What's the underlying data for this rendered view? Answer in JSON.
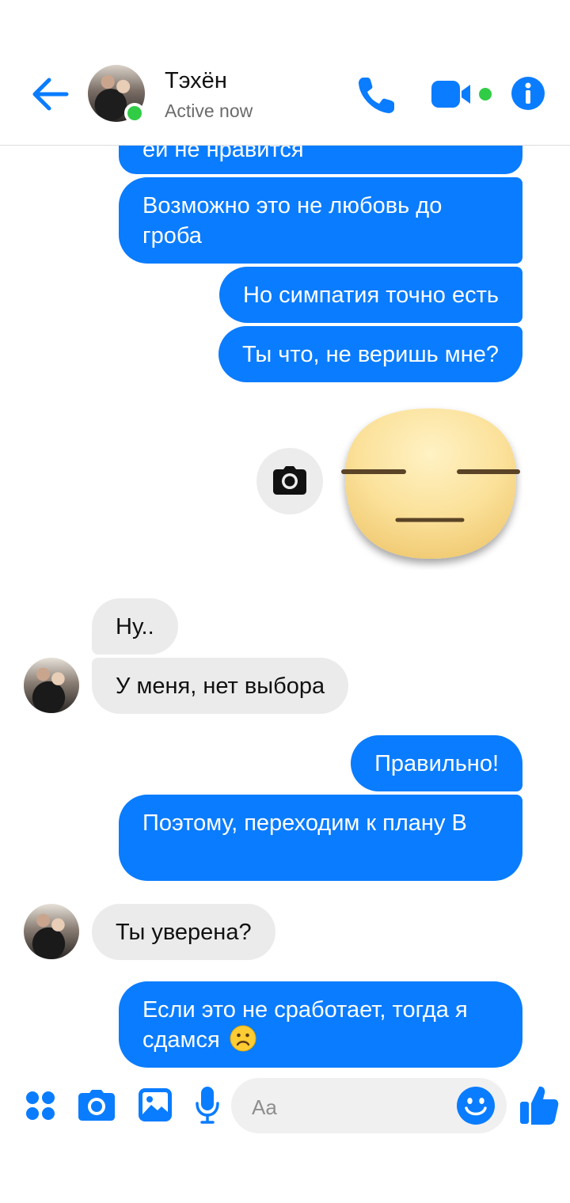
{
  "header": {
    "contact_name": "Тэхён",
    "status": "Active now"
  },
  "colors": {
    "accent": "#0a7cff",
    "incoming_bubble": "#ebebeb",
    "online": "#31cc46"
  },
  "messages": [
    {
      "side": "out",
      "text": "ей не нравится"
    },
    {
      "side": "out",
      "text": "Возможно это не любовь до гроба"
    },
    {
      "side": "out",
      "text": "Но симпатия точно есть"
    },
    {
      "side": "out",
      "text": "Ты что, не веришь мне?"
    },
    {
      "side": "out",
      "sticker": "expressionless-face-sticker"
    },
    {
      "side": "in",
      "text": "Ну.."
    },
    {
      "side": "in",
      "text": "У меня, нет выбора"
    },
    {
      "side": "out",
      "text": "Правильно!"
    },
    {
      "side": "out",
      "text": "Поэтому, переходим к плану В"
    },
    {
      "side": "in",
      "text": "Ты уверена?"
    },
    {
      "side": "out",
      "text": "Если это не сработает, тогда я сдамся",
      "emoji": "frowning-face"
    }
  ],
  "composer": {
    "placeholder": "Aa",
    "value": ""
  },
  "icons": {
    "back": "back-arrow-icon",
    "call": "phone-icon",
    "video": "video-camera-icon",
    "info": "info-icon",
    "apps": "apps-grid-icon",
    "camera": "camera-icon",
    "gallery": "gallery-icon",
    "mic": "microphone-icon",
    "emoji": "smile-icon",
    "like": "thumbs-up-icon"
  }
}
